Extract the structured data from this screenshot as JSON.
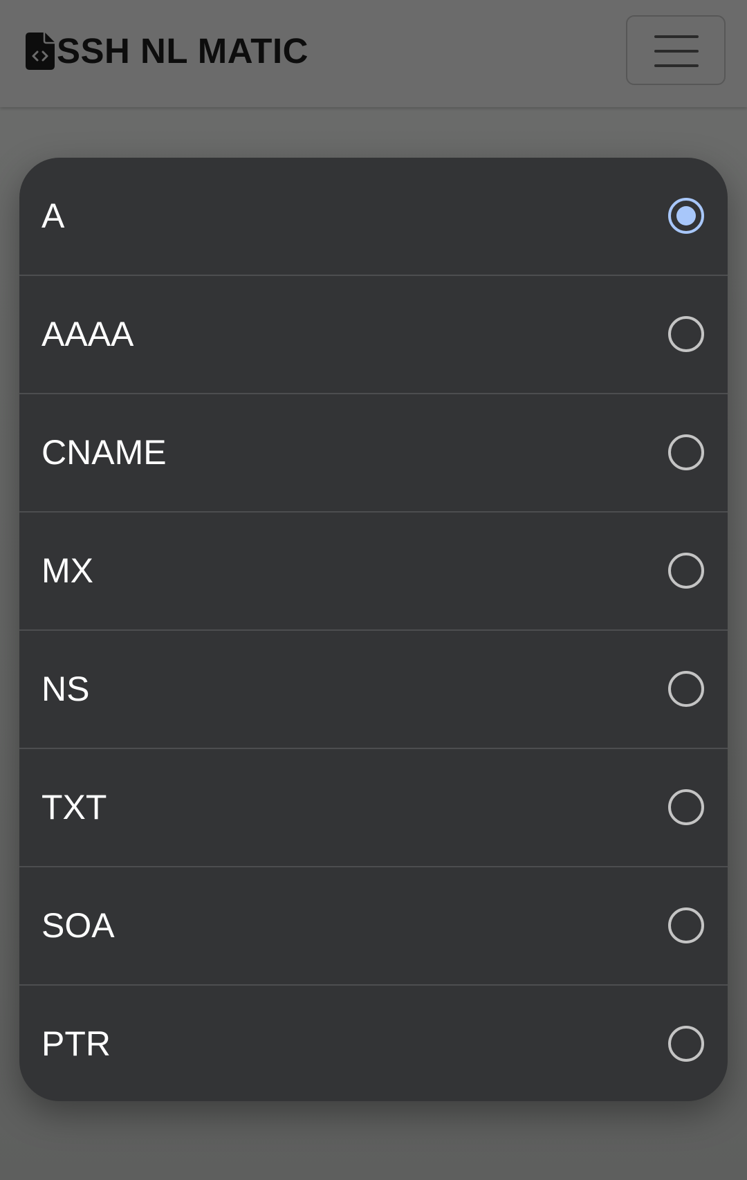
{
  "navbar": {
    "brand_icon": "file-code-icon",
    "brand_text": "SSH NL MATIC",
    "menu_icon": "hamburger-menu-icon"
  },
  "dialog": {
    "selected_index": 0,
    "accent_color": "#a8c7fa",
    "options": [
      {
        "label": "A",
        "checked": true
      },
      {
        "label": "AAAA",
        "checked": false
      },
      {
        "label": "CNAME",
        "checked": false
      },
      {
        "label": "MX",
        "checked": false
      },
      {
        "label": "NS",
        "checked": false
      },
      {
        "label": "TXT",
        "checked": false
      },
      {
        "label": "SOA",
        "checked": false
      },
      {
        "label": "PTR",
        "checked": false
      }
    ]
  }
}
